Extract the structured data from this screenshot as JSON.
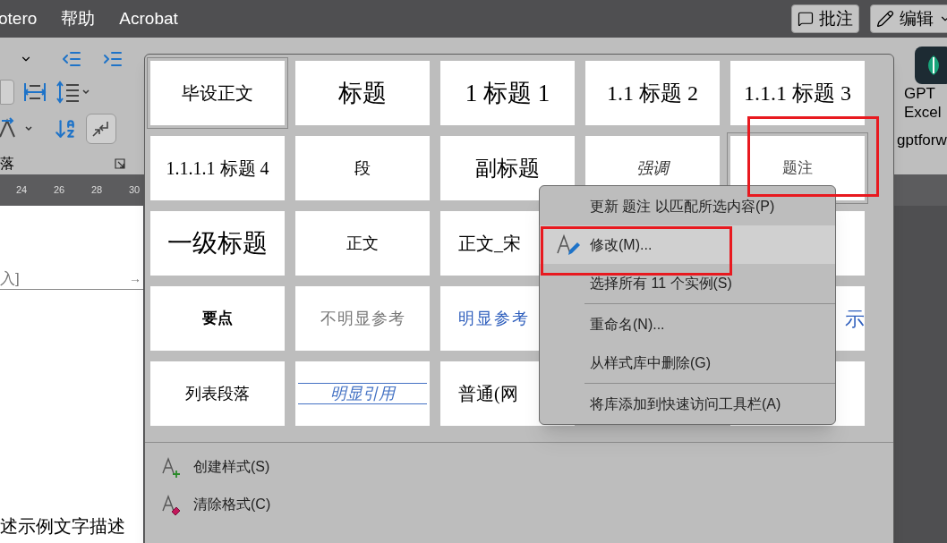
{
  "menu_bar": {
    "tabs": [
      "otero",
      "帮助",
      "Acrobat"
    ],
    "buttons": [
      "批注",
      "编辑"
    ]
  },
  "ribbon": {
    "group_label": "落",
    "addin_name": [
      "GPT",
      "Excel"
    ],
    "addin_group": "gptforw"
  },
  "ruler": {
    "ticks": [
      "24",
      "26",
      "28",
      "30"
    ]
  },
  "document": {
    "field_text": "入]",
    "field_arrow": "→",
    "body_text": "述示例文字描述"
  },
  "style_gallery": {
    "cells": [
      {
        "text": "毕设正文",
        "kind": "body-large",
        "selected": true
      },
      {
        "text": "标题",
        "kind": "title",
        "selected": false
      },
      {
        "text": "1  标题 1",
        "kind": "title",
        "selected": false
      },
      {
        "text": "1.1  标题 2",
        "kind": "heading",
        "selected": false
      },
      {
        "text": "1.1.1  标题 3",
        "kind": "heading",
        "selected": false
      },
      {
        "text": "1.1.1.1  标题 4",
        "kind": "body-large",
        "selected": false
      },
      {
        "text": "段",
        "kind": "body",
        "selected": false
      },
      {
        "text": "副标题",
        "kind": "heading",
        "selected": false
      },
      {
        "text": "强调",
        "kind": "emphasis",
        "selected": false
      },
      {
        "text": "题注",
        "kind": "caption",
        "selected": true
      },
      {
        "text": "一级标题",
        "kind": "sans-large",
        "selected": false
      },
      {
        "text": "正文",
        "kind": "body",
        "selected": false
      },
      {
        "text": "正文_宋",
        "kind": "body-large",
        "selected": false
      },
      {
        "kind": "hidden"
      },
      {
        "kind": "empty",
        "selected": false
      },
      {
        "text": "要点",
        "kind": "strong",
        "selected": false
      },
      {
        "text": "不明显参考",
        "kind": "subtle-reference",
        "selected": false
      },
      {
        "text": "明显参考",
        "kind": "strong-reference",
        "selected": false
      },
      {
        "kind": "hidden"
      },
      {
        "text": "示",
        "kind": "strong-reference-edge",
        "selected": false
      },
      {
        "text": "列表段落",
        "kind": "body",
        "selected": false
      },
      {
        "text": "明显引用",
        "kind": "quote",
        "selected": false
      },
      {
        "text": "普通(网",
        "kind": "body-large",
        "selected": false
      },
      {
        "kind": "hidden"
      },
      {
        "kind": "empty",
        "selected": false
      }
    ],
    "actions": [
      {
        "label": "创建样式(S)",
        "kind": "create"
      },
      {
        "label": "清除格式(C)",
        "kind": "clear"
      }
    ]
  },
  "context_menu": {
    "items": [
      {
        "label": "更新 题注 以匹配所选内容(P)",
        "highlighted": false,
        "separator_before": false,
        "kind": "plain"
      },
      {
        "label": "修改(M)...",
        "highlighted": true,
        "separator_before": false,
        "kind": "modify"
      },
      {
        "label": "选择所有 11 个实例(S)",
        "highlighted": false,
        "separator_before": false,
        "kind": "plain"
      },
      {
        "label": "重命名(N)...",
        "highlighted": false,
        "separator_before": true,
        "kind": "plain"
      },
      {
        "label": "从样式库中删除(G)",
        "highlighted": false,
        "separator_before": false,
        "kind": "plain"
      },
      {
        "label": "将库添加到快速访问工具栏(A)",
        "highlighted": false,
        "separator_before": true,
        "kind": "plain"
      }
    ]
  }
}
